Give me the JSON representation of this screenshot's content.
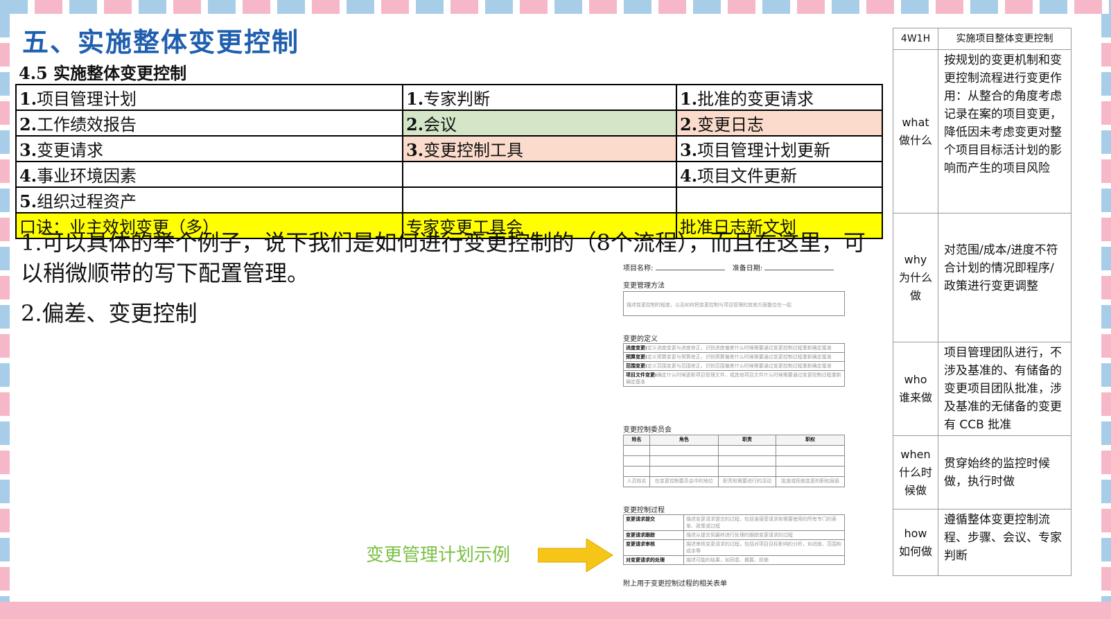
{
  "slide": {
    "title": "五、实施整体变更控制"
  },
  "ito_table": {
    "header": "4.5 实施整体变更控制",
    "rows": [
      {
        "inputs": {
          "n": "1.",
          "t": "项目管理计划"
        },
        "tools": {
          "n": "1.",
          "t": "专家判断"
        },
        "outputs": {
          "n": "1.",
          "t": "批准的变更请求"
        }
      },
      {
        "inputs": {
          "n": "2.",
          "t": "工作绩效报告"
        },
        "tools": {
          "n": "2.",
          "t": "会议"
        },
        "outputs": {
          "n": "2.",
          "t": "变更日志"
        }
      },
      {
        "inputs": {
          "n": "3.",
          "t": "变更请求"
        },
        "tools": {
          "n": "3.",
          "t": "变更控制工具"
        },
        "outputs": {
          "n": "3.",
          "t": "项目管理计划更新"
        }
      },
      {
        "inputs": {
          "n": "4.",
          "t": "事业环境因素"
        },
        "tools": {
          "n": "",
          "t": ""
        },
        "outputs": {
          "n": "4.",
          "t": "项目文件更新"
        }
      },
      {
        "inputs": {
          "n": "5.",
          "t": "组织过程资产"
        },
        "tools": {
          "n": "",
          "t": ""
        },
        "outputs": {
          "n": "",
          "t": ""
        }
      }
    ],
    "mnemonic": {
      "inputs": "口诀：业主效划变更（多）",
      "tools": "专家变更工具会",
      "outputs": "批准日志新文划"
    },
    "colors": {
      "green": "#d4e6c7",
      "peach": "#fbdccc",
      "yellow": "#ffff00"
    }
  },
  "body": {
    "p1": "1.可以具体的举个例子，说下我们是如何进行变更控制的（8个流程），而且在这里，可以稍微顺带的写下配置管理。",
    "p2": "2.偏差、变更控制"
  },
  "form": {
    "project_name_label": "项目名称:",
    "date_label": "准备日期:",
    "method_title": "变更管理方法",
    "method_desc": "描述变更控制的程度，以及如何把变更控制与项目管理的其他方面整合在一起",
    "definition_title": "变更的定义",
    "definitions": [
      {
        "label": "进度变更:",
        "desc": "定义进度变更与进度修正，识别进度偏差什么时候需要通过变更控制过程重新确定基准"
      },
      {
        "label": "预算变更:",
        "desc": "定义预算变更与预算修正，识别预算偏差什么时候需要通过变更控制过程重新确定基准"
      },
      {
        "label": "范围变更:",
        "desc": "定义范围变更与范围修正，识别范围偏差什么时候需要通过变更控制过程重新确定基准"
      },
      {
        "label": "项目文件变更:",
        "desc": "确定什么时候更新项目管理文件，或其他项目文件什么时候需要通过变更控制过程重新确定基准"
      }
    ],
    "ccb_title": "变更控制委员会",
    "ccb_headers": [
      "姓名",
      "角色",
      "职责",
      "职权"
    ],
    "ccb_hints": [
      "人员姓名",
      "在变更控制委员会中的地位",
      "职责和需要进行的活动",
      "批准或拒绝变更的职权层级"
    ],
    "process_title": "变更控制过程",
    "process": [
      {
        "label": "变更请求提交",
        "desc": "描述变更请求提交的过程，包括谁接受请求和需要使用的所有专门的表单、政策或过程"
      },
      {
        "label": "变更请求跟踪",
        "desc": "描述从提交到最终进行处理的跟踪变更请求的过程"
      },
      {
        "label": "变更请求审核",
        "desc": "描述审核变更请求的过程，包括对项目目标影响的分析，如进度、范围和成本等"
      },
      {
        "label": "对变更请求的处理",
        "desc": "描述可能的结果，如同意、搁置、拒绝"
      }
    ],
    "footer": "附上用于变更控制过程的相关表单"
  },
  "caption": "变更管理计划示例",
  "w4h": {
    "header": [
      "4W1H",
      "实施项目整体变更控制"
    ],
    "rows": [
      {
        "key_en": "what",
        "key_cn": "做什么",
        "text": "按规划的变更机制和变更控制流程进行变更作用：从整合的角度考虑记录在案的项目变更，降低因未考虑变更对整个项目目标活计划的影响而产生的项目风险"
      },
      {
        "key_en": "why",
        "key_cn": "为什么做",
        "text": "对范围/成本/进度不符合计划的情况即程序/政策进行变更调整"
      },
      {
        "key_en": "who",
        "key_cn": "谁来做",
        "text": "项目管理团队进行，不涉及基准的、有储备的变更项目团队批准，涉及基准的无储备的变更有 CCB 批准"
      },
      {
        "key_en": "when",
        "key_cn": "什么时候做",
        "text": "贯穿始终的监控时候做，执行时做"
      },
      {
        "key_en": "how",
        "key_cn": "如何做",
        "text": "遵循整体变更控制流程、步骤、会议、专家判断"
      }
    ]
  }
}
